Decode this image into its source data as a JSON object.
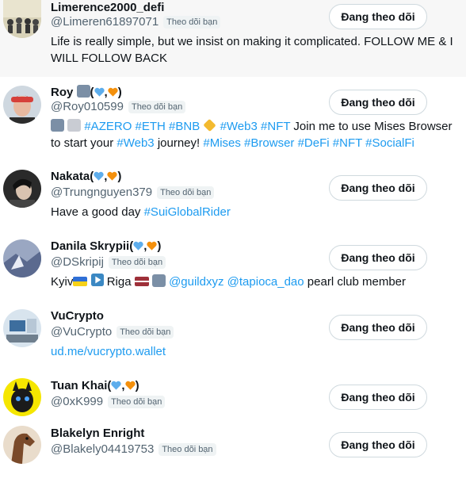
{
  "follow_label": "Đang theo dõi",
  "badge_label": "Theo dõi bạn",
  "colors": {
    "link": "#1d9bf0",
    "muted": "#536471",
    "badge_bg": "#eff3f4",
    "highlight_bg": "#f7f7f7"
  },
  "users": [
    {
      "name": "Limerence2000_defi",
      "handle": "@Limeren61897071",
      "bio": "Life is really simple, but we insist on making it complicated. FOLLOW ME & I WILL FOLLOW BACK"
    },
    {
      "name": "Roy",
      "name_suffix": "(",
      "name_sep": ",",
      "name_end": ")",
      "handle": "@Roy010599",
      "bio_tags": [
        "#AZERO",
        "#ETH",
        "#BNB",
        "#Web3",
        "#NFT"
      ],
      "bio_text_1": "Join me to use Mises Browser to start your",
      "bio_tag_web3": "#Web3",
      "bio_text_2": "journey!",
      "bio_tags_2": [
        "#Mises",
        "#Browser",
        "#DeFi",
        "#NFT",
        "#SocialFi"
      ]
    },
    {
      "name": "Nakata",
      "name_suffix": "(",
      "name_sep": ",",
      "name_end": ")",
      "handle": "@Trungnguyen379",
      "bio_text": "Have a good day",
      "bio_tag": "#SuiGlobalRider"
    },
    {
      "name": "Danila Skrypii",
      "name_suffix": "(",
      "name_sep": ",",
      "name_end": ")",
      "handle": "@DSkripij",
      "bio_city_1": "Kyiv",
      "bio_city_2": "Riga",
      "bio_mention_1": "@guildxyz",
      "bio_mention_2": "@tapioca_dao",
      "bio_text": "pearl club member"
    },
    {
      "name": "VuCrypto",
      "handle": "@VuCrypto",
      "bio_link": "ud.me/vucrypto.wallet"
    },
    {
      "name": "Tuan Khai",
      "name_suffix": "(",
      "name_sep": ",",
      "name_end": ")",
      "handle": "@0xK999"
    },
    {
      "name": "Blakelyn Enright",
      "handle": "@Blakely04419753"
    }
  ]
}
